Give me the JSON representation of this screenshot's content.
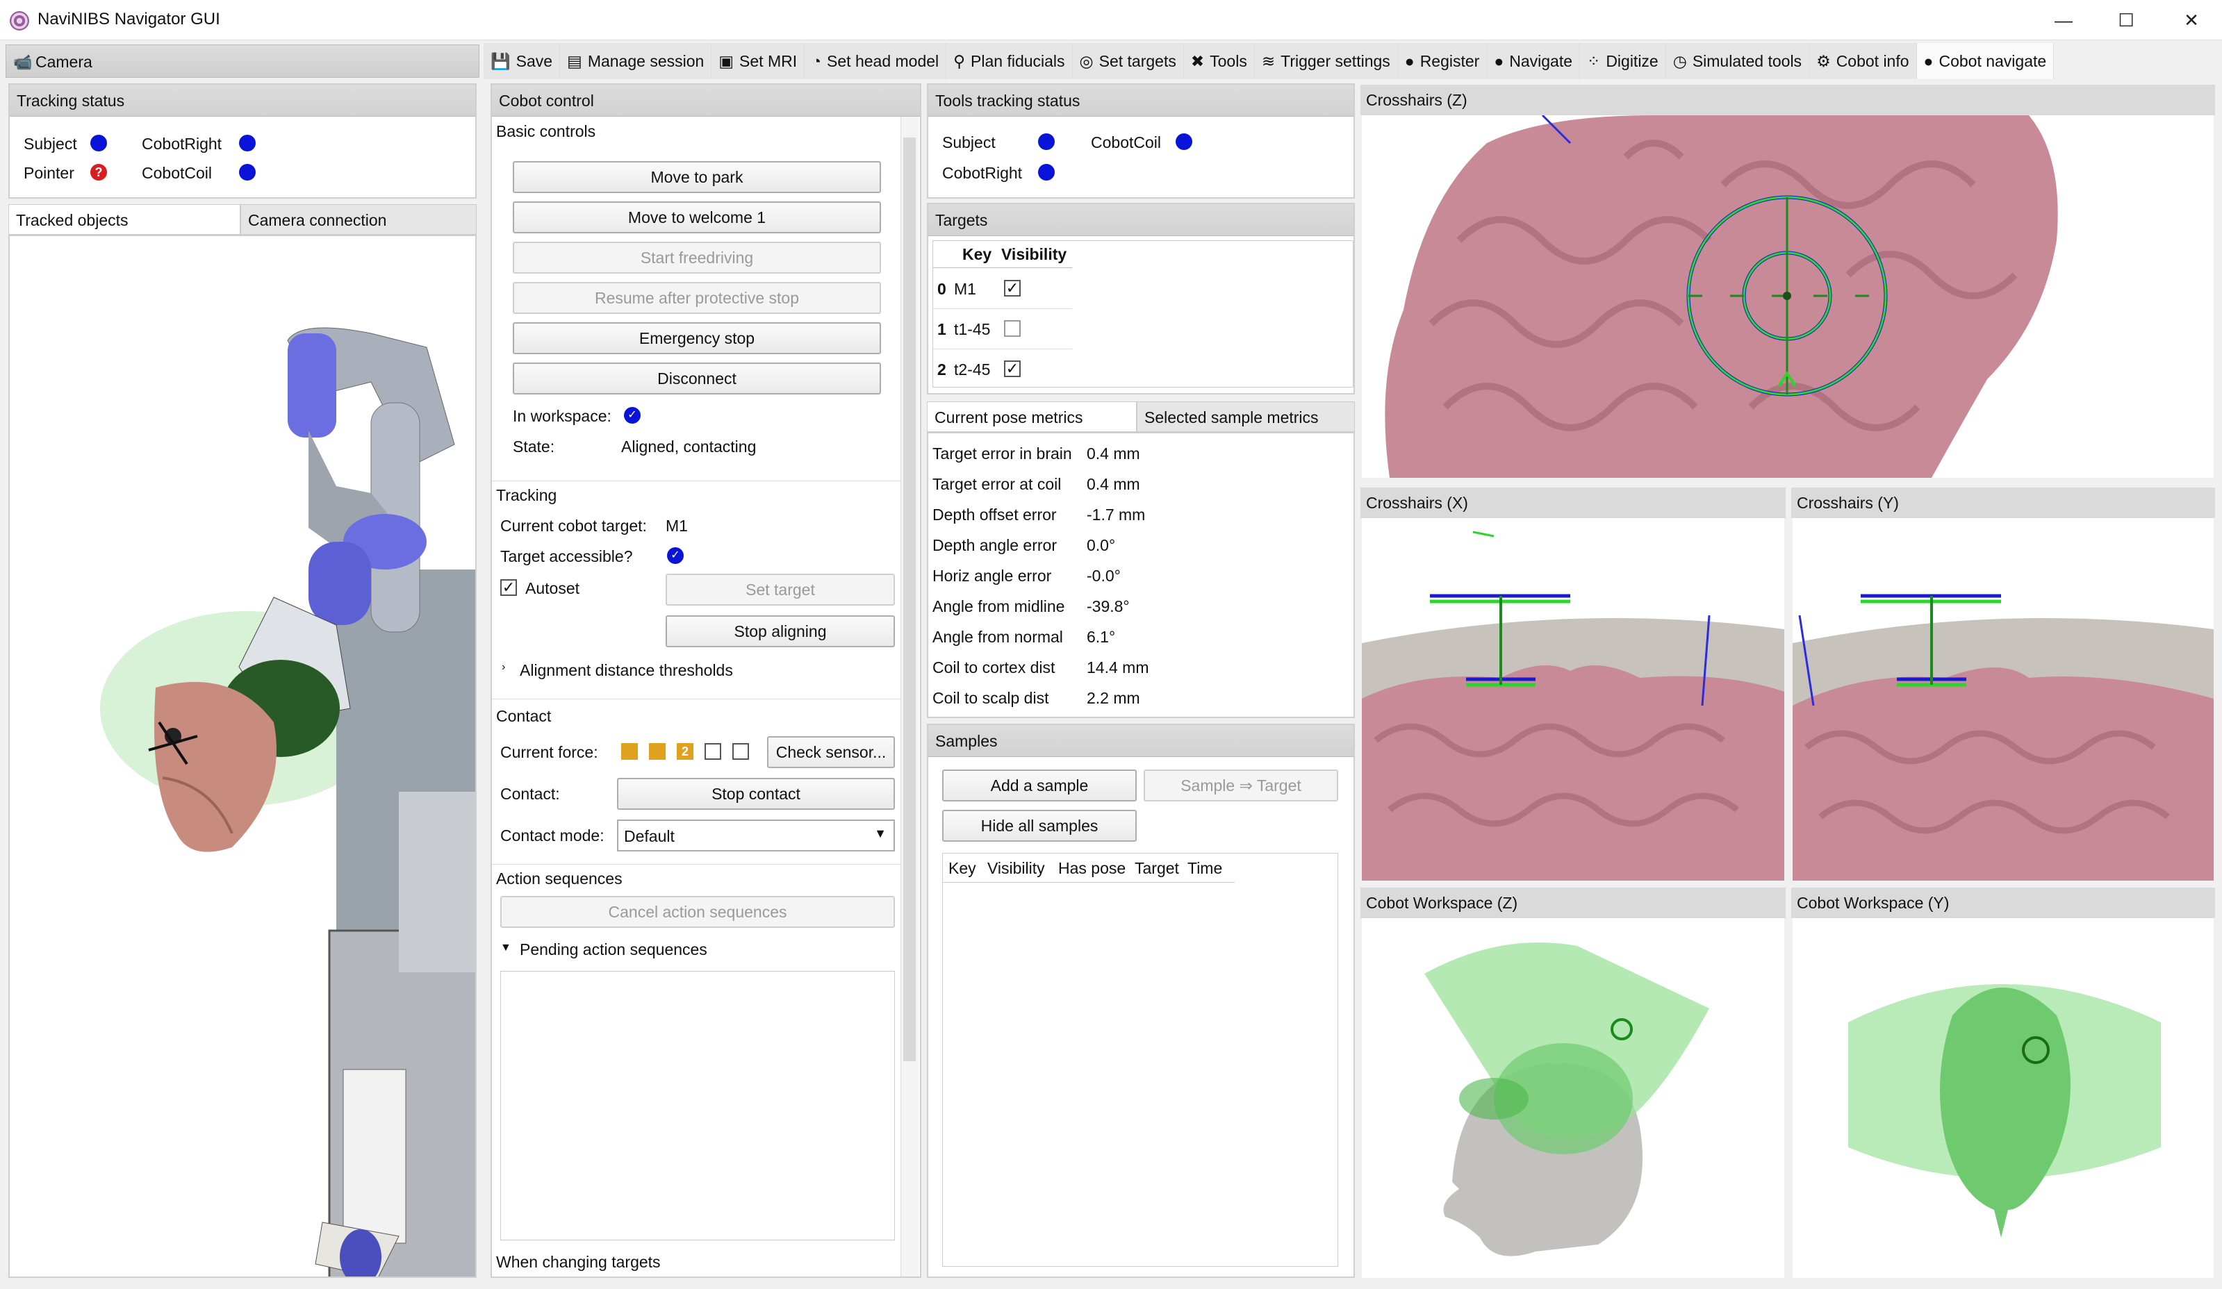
{
  "window": {
    "title": "NaviNIBS Navigator GUI",
    "minimize": "—",
    "maximize": "☐",
    "close": "✕"
  },
  "camera": {
    "title": "Camera"
  },
  "tracking_status": {
    "title": "Tracking status",
    "items": [
      {
        "label": "Subject"
      },
      {
        "label": "CobotRight"
      },
      {
        "label": "Pointer"
      },
      {
        "label": "CobotCoil"
      }
    ]
  },
  "camera_tabs": [
    "Tracked objects",
    "Camera connection"
  ],
  "tabs": [
    {
      "label": "Save",
      "icon": "save-icon"
    },
    {
      "label": "Manage session",
      "icon": "list-icon"
    },
    {
      "label": "Set MRI",
      "icon": "image-icon"
    },
    {
      "label": "Set head model",
      "icon": "head-icon"
    },
    {
      "label": "Plan fiducials",
      "icon": "pin-icon"
    },
    {
      "label": "Set targets",
      "icon": "target-icon"
    },
    {
      "label": "Tools",
      "icon": "tools-icon"
    },
    {
      "label": "Trigger settings",
      "icon": "trigger-icon"
    },
    {
      "label": "Register",
      "icon": "register-icon"
    },
    {
      "label": "Navigate",
      "icon": "navigate-icon"
    },
    {
      "label": "Digitize",
      "icon": "digitize-icon"
    },
    {
      "label": "Simulated tools",
      "icon": "sim-icon"
    },
    {
      "label": "Cobot info",
      "icon": "cobot-icon"
    },
    {
      "label": "Cobot navigate",
      "icon": "cobot-nav-icon"
    }
  ],
  "cobot": {
    "title": "Cobot control",
    "basic": "Basic controls",
    "buttons": [
      "Move to park",
      "Move to welcome 1",
      "Start freedriving",
      "Resume after protective stop",
      "Emergency stop",
      "Disconnect"
    ],
    "in_workspace": "In workspace:",
    "state_label": "State:",
    "state": "Aligned, contacting",
    "tracking": "Tracking",
    "current_target_label": "Current cobot target:",
    "current_target": "M1",
    "accessible": "Target accessible?",
    "autoset": "Autoset",
    "set_target": "Set target",
    "stop_aligning": "Stop aligning",
    "thresholds": "Alignment distance thresholds",
    "contact": "Contact",
    "current_force": "Current force:",
    "force_level": "2",
    "check_sensor": "Check sensor...",
    "contact_label": "Contact:",
    "stop_contact": "Stop contact",
    "contact_mode_label": "Contact mode:",
    "contact_mode": "Default",
    "action_sequences": "Action sequences",
    "cancel_actions": "Cancel action sequences",
    "pending": "Pending action sequences",
    "changing": "When changing targets"
  },
  "tools_status": {
    "title": "Tools tracking status",
    "items": [
      {
        "label": "Subject"
      },
      {
        "label": "CobotCoil"
      },
      {
        "label": "CobotRight"
      }
    ]
  },
  "targets": {
    "title": "Targets",
    "headers": [
      "Key",
      "Visibility"
    ],
    "rows": [
      {
        "idx": "0",
        "key": "M1",
        "check": "✓"
      },
      {
        "idx": "1",
        "key": "t1-45",
        "check": ""
      },
      {
        "idx": "2",
        "key": "t2-45",
        "check": "✓"
      }
    ]
  },
  "metrics": {
    "tabs": [
      "Current pose metrics",
      "Selected sample metrics"
    ],
    "rows": [
      {
        "label": "Target error in brain",
        "value": "0.4 mm"
      },
      {
        "label": "Target error at coil",
        "value": "0.4 mm"
      },
      {
        "label": "Depth offset error",
        "value": "-1.7 mm"
      },
      {
        "label": "Depth angle error",
        "value": "0.0°"
      },
      {
        "label": "Horiz angle error",
        "value": "-0.0°"
      },
      {
        "label": "Angle from midline",
        "value": "-39.8°"
      },
      {
        "label": "Angle from normal",
        "value": "6.1°"
      },
      {
        "label": "Coil to cortex dist",
        "value": "14.4 mm"
      },
      {
        "label": "Coil to scalp dist",
        "value": "2.2 mm"
      }
    ]
  },
  "samples": {
    "title": "Samples",
    "add": "Add a sample",
    "to_target": "Sample ⇒ Target",
    "hide_all": "Hide all samples",
    "headers": [
      "Key",
      "Visibility",
      "Has pose",
      "Target",
      "Time"
    ]
  },
  "views": {
    "z": "Crosshairs (Z)",
    "x": "Crosshairs (X)",
    "y": "Crosshairs (Y)",
    "wz": "Cobot Workspace (Z)",
    "wy": "Cobot Workspace (Y)"
  }
}
